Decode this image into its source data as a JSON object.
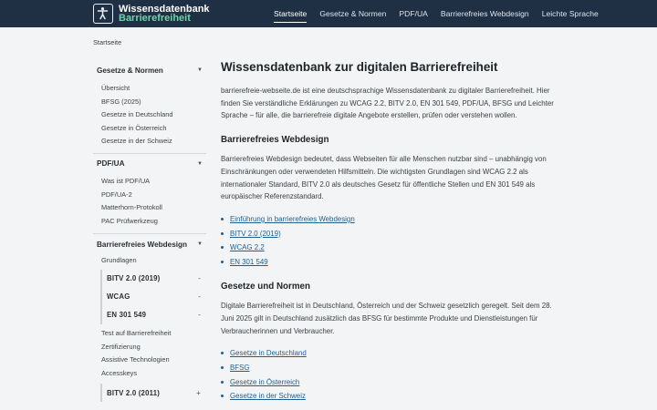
{
  "site": {
    "logo_line1": "Wissensdatenbank",
    "logo_line2": "Barrierefreiheit"
  },
  "topnav": [
    {
      "label": "Startseite",
      "active": true
    },
    {
      "label": "Gesetze & Normen",
      "active": false
    },
    {
      "label": "PDF/UA",
      "active": false
    },
    {
      "label": "Barrierefreies Webdesign",
      "active": false
    },
    {
      "label": "Leichte Sprache",
      "active": false
    }
  ],
  "breadcrumb": "Startseite",
  "sidebar": {
    "gesetze": {
      "title": "Gesetze & Normen",
      "items": [
        "Übersicht",
        "BFSG (2025)",
        "Gesetze in Deutschland",
        "Gesetze in Österreich",
        "Gesetze in der Schweiz"
      ]
    },
    "pdfua": {
      "title": "PDF/UA",
      "items": [
        "Was ist PDF/UA",
        "PDF/UA-2",
        "Matterhorn-Protokoll",
        "PAC Prüfwerkzeug"
      ]
    },
    "webdesign": {
      "title": "Barrierefreies Webdesign",
      "grundlagen": "Grundlagen",
      "nested": [
        {
          "label": "BITV 2.0 (2019)",
          "toggle": "-"
        },
        {
          "label": "WCAG",
          "toggle": "-"
        },
        {
          "label": "EN 301 549",
          "toggle": "-"
        }
      ],
      "items": [
        "Test auf Barrierefreiheit",
        "Zertifizierung",
        "Assistive Technologien",
        "Accesskeys"
      ],
      "nested2": {
        "label": "BITV 2.0 (2011)",
        "toggle": "+"
      }
    }
  },
  "main": {
    "title": "Wissensdatenbank zur digitalen Barrierefreiheit",
    "intro": "barrierefreie-webseite.de ist eine deutschsprachige Wissensdatenbank zu digitaler Barrierefreiheit. Hier finden Sie verständliche Erklärungen zu WCAG 2.2, BITV 2.0, EN 301 549, PDF/UA, BFSG und Leichter Sprache – für alle, die barrierefreie digitale Angebote erstellen, prüfen oder verstehen wollen.",
    "web": {
      "heading": "Barrierefreies Webdesign",
      "text": "Barrierefreies Webdesign bedeutet, dass Webseiten für alle Menschen nutzbar sind – unabhängig von Einschränkungen oder verwendeten Hilfsmitteln. Die wichtigsten Grundlagen sind WCAG 2.2 als internationaler Standard, BITV 2.0 als deutsches Gesetz für öffentliche Stellen und EN 301 549 als europäischer Referenzstandard.",
      "links": [
        "Einführung in barrierefreies Webdesign",
        "BITV 2.0 (2019)",
        "WCAG 2.2",
        "EN 301 549"
      ]
    },
    "law": {
      "heading": "Gesetze und Normen",
      "text": "Digitale Barrierefreiheit ist in Deutschland, Österreich und der Schweiz gesetzlich geregelt. Seit dem 28. Juni 2025 gilt in Deutschland zusätzlich das BFSG für bestimmte Produkte und Dienstleistungen für Verbraucherinnen und Verbraucher.",
      "links": [
        "Gesetze in Deutschland",
        "BFSG",
        "Gesetze in Österreich",
        "Gesetze in der Schweiz"
      ]
    }
  }
}
